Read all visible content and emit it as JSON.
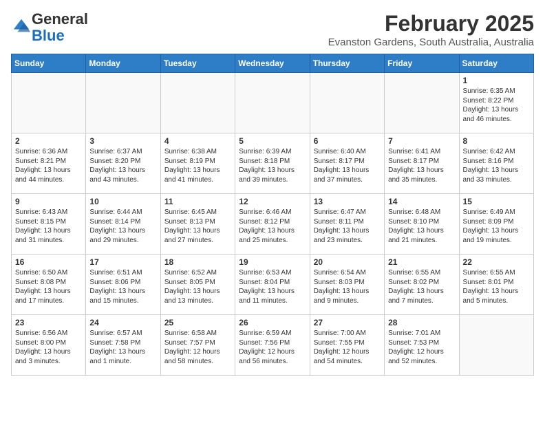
{
  "header": {
    "logo_general": "General",
    "logo_blue": "Blue",
    "month_year": "February 2025",
    "location": "Evanston Gardens, South Australia, Australia"
  },
  "weekdays": [
    "Sunday",
    "Monday",
    "Tuesday",
    "Wednesday",
    "Thursday",
    "Friday",
    "Saturday"
  ],
  "weeks": [
    [
      {
        "day": "",
        "info": ""
      },
      {
        "day": "",
        "info": ""
      },
      {
        "day": "",
        "info": ""
      },
      {
        "day": "",
        "info": ""
      },
      {
        "day": "",
        "info": ""
      },
      {
        "day": "",
        "info": ""
      },
      {
        "day": "1",
        "info": "Sunrise: 6:35 AM\nSunset: 8:22 PM\nDaylight: 13 hours\nand 46 minutes."
      }
    ],
    [
      {
        "day": "2",
        "info": "Sunrise: 6:36 AM\nSunset: 8:21 PM\nDaylight: 13 hours\nand 44 minutes."
      },
      {
        "day": "3",
        "info": "Sunrise: 6:37 AM\nSunset: 8:20 PM\nDaylight: 13 hours\nand 43 minutes."
      },
      {
        "day": "4",
        "info": "Sunrise: 6:38 AM\nSunset: 8:19 PM\nDaylight: 13 hours\nand 41 minutes."
      },
      {
        "day": "5",
        "info": "Sunrise: 6:39 AM\nSunset: 8:18 PM\nDaylight: 13 hours\nand 39 minutes."
      },
      {
        "day": "6",
        "info": "Sunrise: 6:40 AM\nSunset: 8:17 PM\nDaylight: 13 hours\nand 37 minutes."
      },
      {
        "day": "7",
        "info": "Sunrise: 6:41 AM\nSunset: 8:17 PM\nDaylight: 13 hours\nand 35 minutes."
      },
      {
        "day": "8",
        "info": "Sunrise: 6:42 AM\nSunset: 8:16 PM\nDaylight: 13 hours\nand 33 minutes."
      }
    ],
    [
      {
        "day": "9",
        "info": "Sunrise: 6:43 AM\nSunset: 8:15 PM\nDaylight: 13 hours\nand 31 minutes."
      },
      {
        "day": "10",
        "info": "Sunrise: 6:44 AM\nSunset: 8:14 PM\nDaylight: 13 hours\nand 29 minutes."
      },
      {
        "day": "11",
        "info": "Sunrise: 6:45 AM\nSunset: 8:13 PM\nDaylight: 13 hours\nand 27 minutes."
      },
      {
        "day": "12",
        "info": "Sunrise: 6:46 AM\nSunset: 8:12 PM\nDaylight: 13 hours\nand 25 minutes."
      },
      {
        "day": "13",
        "info": "Sunrise: 6:47 AM\nSunset: 8:11 PM\nDaylight: 13 hours\nand 23 minutes."
      },
      {
        "day": "14",
        "info": "Sunrise: 6:48 AM\nSunset: 8:10 PM\nDaylight: 13 hours\nand 21 minutes."
      },
      {
        "day": "15",
        "info": "Sunrise: 6:49 AM\nSunset: 8:09 PM\nDaylight: 13 hours\nand 19 minutes."
      }
    ],
    [
      {
        "day": "16",
        "info": "Sunrise: 6:50 AM\nSunset: 8:08 PM\nDaylight: 13 hours\nand 17 minutes."
      },
      {
        "day": "17",
        "info": "Sunrise: 6:51 AM\nSunset: 8:06 PM\nDaylight: 13 hours\nand 15 minutes."
      },
      {
        "day": "18",
        "info": "Sunrise: 6:52 AM\nSunset: 8:05 PM\nDaylight: 13 hours\nand 13 minutes."
      },
      {
        "day": "19",
        "info": "Sunrise: 6:53 AM\nSunset: 8:04 PM\nDaylight: 13 hours\nand 11 minutes."
      },
      {
        "day": "20",
        "info": "Sunrise: 6:54 AM\nSunset: 8:03 PM\nDaylight: 13 hours\nand 9 minutes."
      },
      {
        "day": "21",
        "info": "Sunrise: 6:55 AM\nSunset: 8:02 PM\nDaylight: 13 hours\nand 7 minutes."
      },
      {
        "day": "22",
        "info": "Sunrise: 6:55 AM\nSunset: 8:01 PM\nDaylight: 13 hours\nand 5 minutes."
      }
    ],
    [
      {
        "day": "23",
        "info": "Sunrise: 6:56 AM\nSunset: 8:00 PM\nDaylight: 13 hours\nand 3 minutes."
      },
      {
        "day": "24",
        "info": "Sunrise: 6:57 AM\nSunset: 7:58 PM\nDaylight: 13 hours\nand 1 minute."
      },
      {
        "day": "25",
        "info": "Sunrise: 6:58 AM\nSunset: 7:57 PM\nDaylight: 12 hours\nand 58 minutes."
      },
      {
        "day": "26",
        "info": "Sunrise: 6:59 AM\nSunset: 7:56 PM\nDaylight: 12 hours\nand 56 minutes."
      },
      {
        "day": "27",
        "info": "Sunrise: 7:00 AM\nSunset: 7:55 PM\nDaylight: 12 hours\nand 54 minutes."
      },
      {
        "day": "28",
        "info": "Sunrise: 7:01 AM\nSunset: 7:53 PM\nDaylight: 12 hours\nand 52 minutes."
      },
      {
        "day": "",
        "info": ""
      }
    ]
  ]
}
